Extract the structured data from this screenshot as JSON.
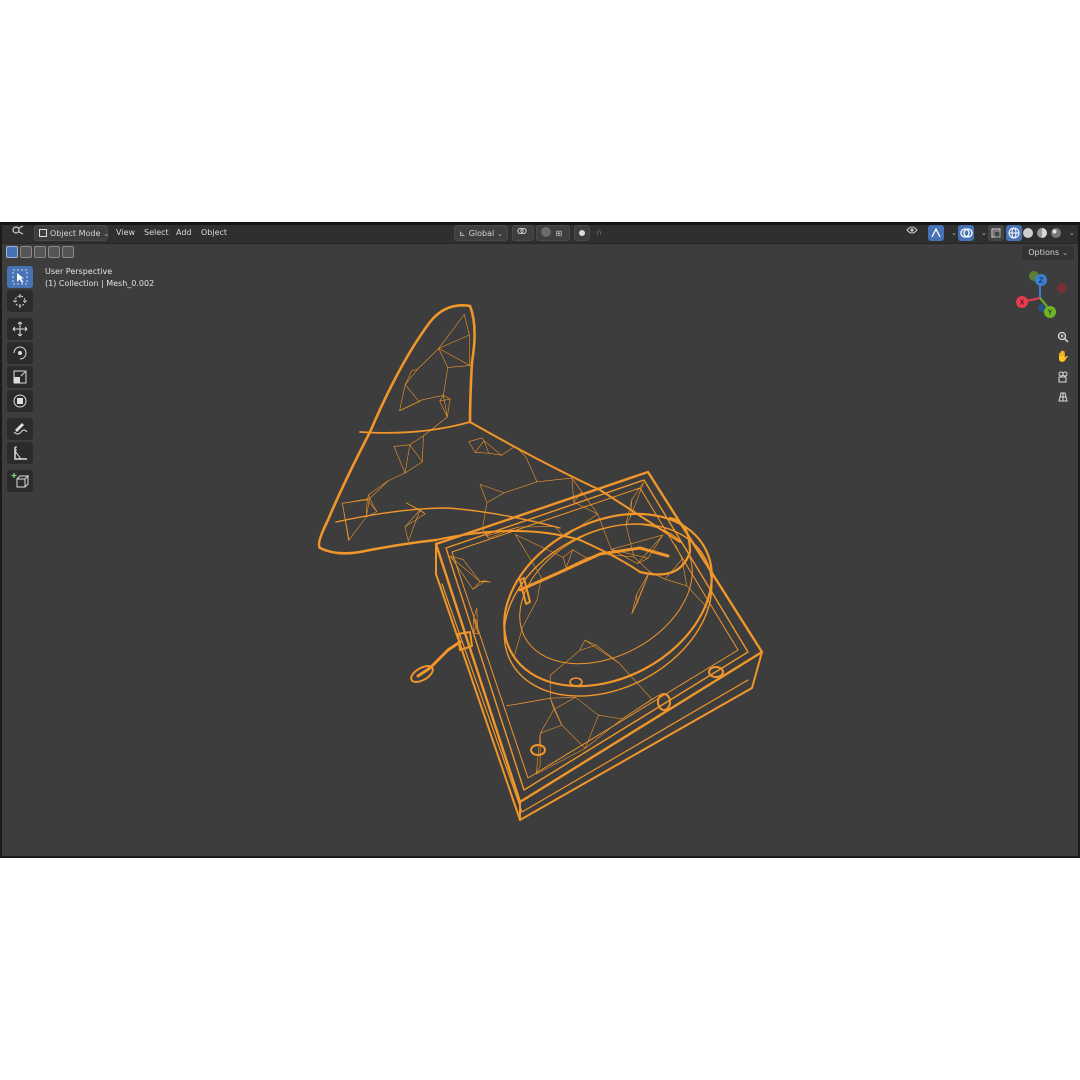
{
  "header": {
    "mode_label": "Object Mode",
    "menus": [
      "View",
      "Select",
      "Add",
      "Object"
    ],
    "transform_orientation": "Global"
  },
  "viewport": {
    "view_name": "User Perspective",
    "collection_info": "(1) Collection | Mesh_0.002",
    "options_label": "Options"
  },
  "gizmo": {
    "z_label": "Z",
    "x_label": "X",
    "y_label": "Y",
    "x_color": "#e8394f",
    "y_color": "#6fb52a",
    "z_color": "#3c7fd6"
  },
  "colors": {
    "wire": "#f0962a",
    "viewport_bg": "#3d3d3d",
    "accent": "#4772b3"
  }
}
